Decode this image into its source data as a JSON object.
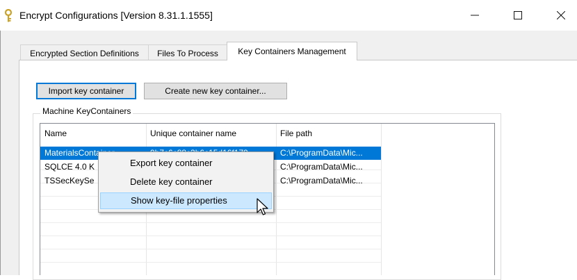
{
  "window": {
    "title": "Encrypt Configurations [Version 8.31.1.1555]",
    "icon": "key-icon",
    "controls": [
      "minimize-icon",
      "maximize-icon",
      "close-icon"
    ]
  },
  "tabs": [
    {
      "label": "Encrypted Section Definitions",
      "active": false
    },
    {
      "label": "Files To Process",
      "active": false
    },
    {
      "label": "Key Containers Management",
      "active": true
    }
  ],
  "buttons": {
    "import_label": "Import key container",
    "create_label": "Create new key container..."
  },
  "group": {
    "label": "Machine KeyContainers"
  },
  "list": {
    "columns": [
      "Name",
      "Unique container name",
      "File path"
    ],
    "rows": [
      {
        "name": "MaterialsContainer",
        "unique": "9b7c6c88c3b6c15d16f179",
        "path": "C:\\ProgramData\\Mic...",
        "selected": true
      },
      {
        "name": "SQLCE 4.0 K",
        "unique": "",
        "path": "C:\\ProgramData\\Mic...",
        "selected": false
      },
      {
        "name": "TSSecKeySe",
        "unique": "",
        "path": "C:\\ProgramData\\Mic...",
        "selected": false
      }
    ]
  },
  "context_menu": {
    "items": [
      {
        "label": "Export key container",
        "hover": false
      },
      {
        "label": "Delete key container",
        "hover": false
      },
      {
        "label": "Show key-file properties",
        "hover": true
      }
    ]
  },
  "colors": {
    "selection": "#0078d7",
    "menu_hover": "#cce8ff",
    "key_icon": "#c9a227"
  }
}
